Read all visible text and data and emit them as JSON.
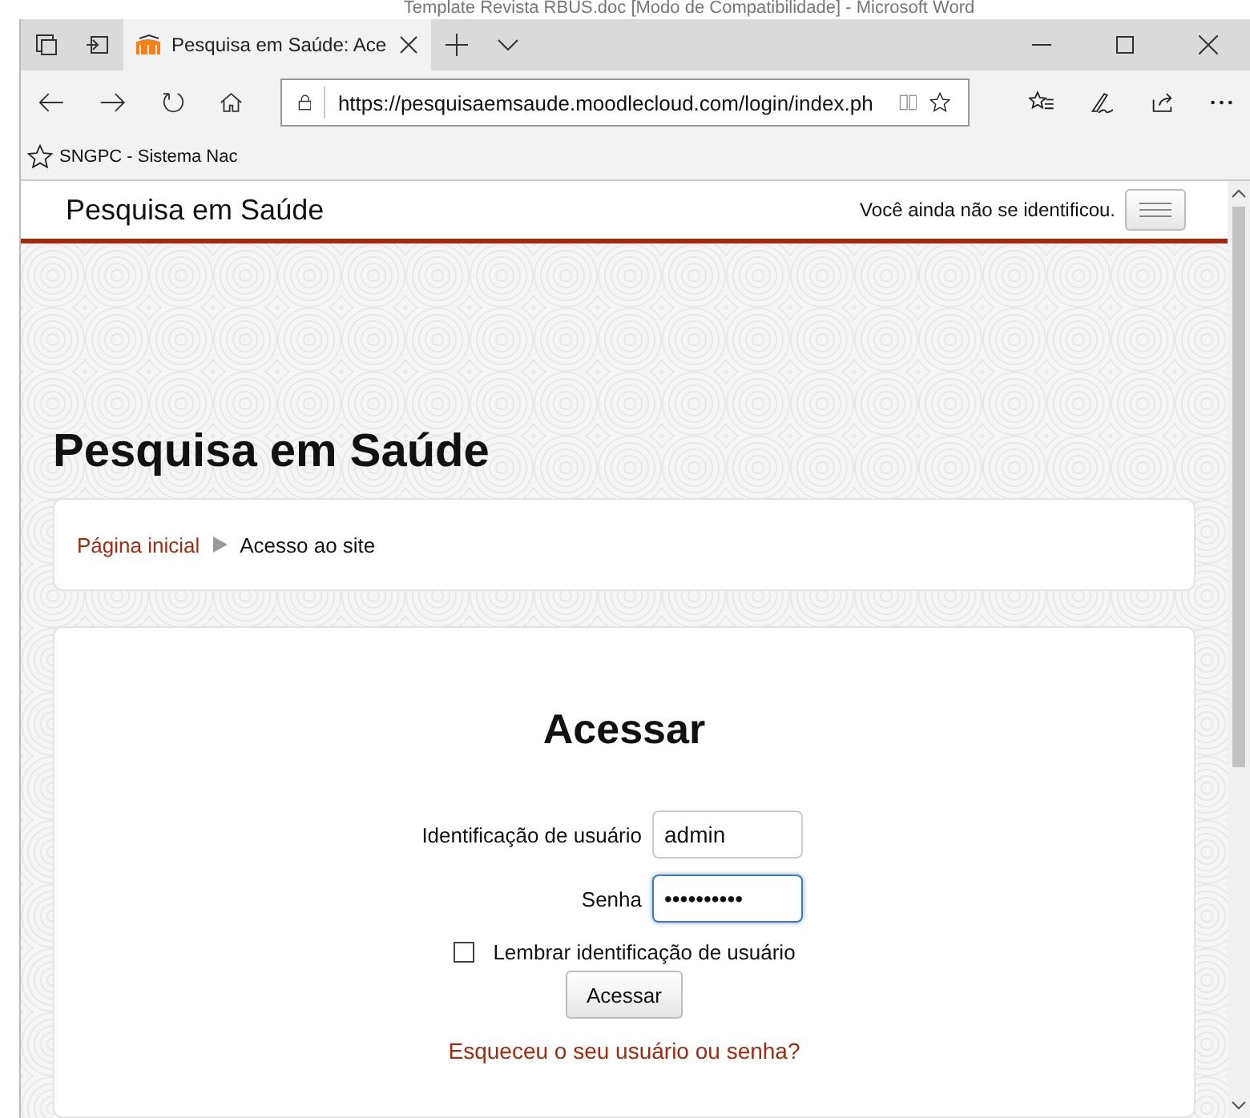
{
  "background_window": {
    "title": "Template Revista RBUS.doc [Modo de Compatibilidade] - Microsoft Word"
  },
  "browser": {
    "tabs": [
      {
        "title": "Pesquisa em Saúde: Ace",
        "selected": true
      }
    ],
    "url": "https://pesquisaemsaude.moodlecloud.com/login/index.ph",
    "bookmarks": [
      {
        "label": "SNGPC - Sistema Nac"
      }
    ]
  },
  "site_header": {
    "site_name": "Pesquisa em Saúde",
    "login_status": "Você ainda não se identificou."
  },
  "page_heading": "Pesquisa em Saúde",
  "breadcrumb": [
    {
      "label": "Página inicial",
      "kind": "link"
    },
    {
      "label": "Acesso ao site",
      "kind": "current"
    }
  ],
  "login": {
    "title": "Acessar",
    "fields": [
      {
        "label": "Identificação de usuário",
        "value": "admin",
        "focused": false
      },
      {
        "label": "Senha",
        "value": "••••••••••",
        "focused": true
      }
    ],
    "remember": {
      "label": "Lembrar identificação de usuário",
      "checked": false
    },
    "submit": "Acessar",
    "forgot_link": "Esqueceu o seu usuário ou senha?"
  }
}
